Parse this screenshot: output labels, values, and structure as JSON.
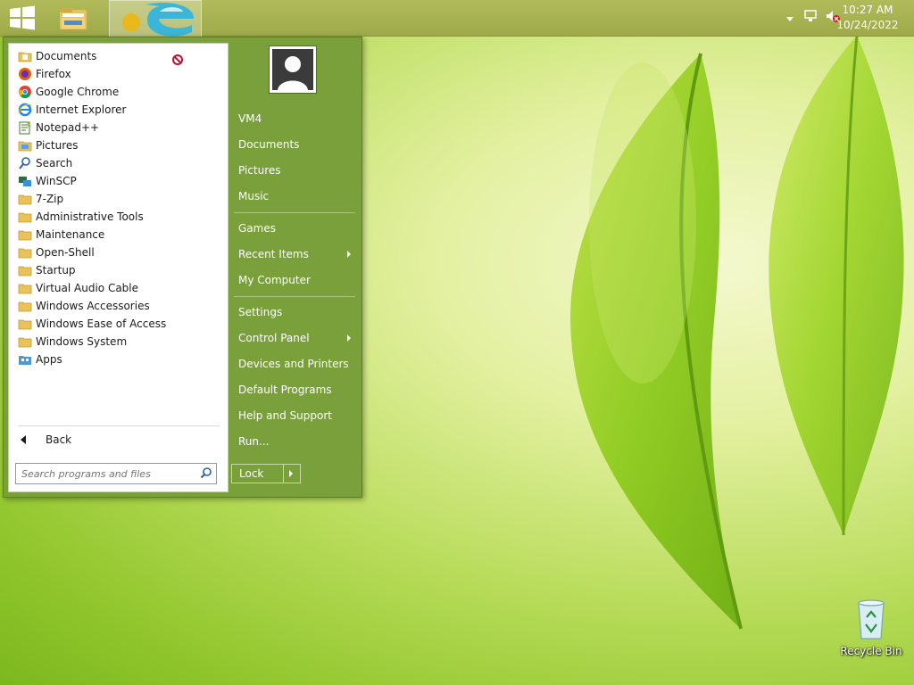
{
  "taskbar": {
    "clock_time": "10:27 AM",
    "clock_date": "10/24/2022",
    "pinned_apps": [
      "file-explorer",
      "internet-explorer"
    ]
  },
  "start_menu": {
    "programs": [
      {
        "label": "Documents",
        "icon": "folder-doc-icon"
      },
      {
        "label": "Firefox",
        "icon": "firefox-icon"
      },
      {
        "label": "Google Chrome",
        "icon": "chrome-icon"
      },
      {
        "label": "Internet Explorer",
        "icon": "ie-icon"
      },
      {
        "label": "Notepad++",
        "icon": "notepad-icon"
      },
      {
        "label": "Pictures",
        "icon": "folder-pictures-icon"
      },
      {
        "label": "Search",
        "icon": "search-icon"
      },
      {
        "label": "WinSCP",
        "icon": "winscp-icon"
      },
      {
        "label": "7-Zip",
        "icon": "folder-icon"
      },
      {
        "label": "Administrative Tools",
        "icon": "folder-icon"
      },
      {
        "label": "Maintenance",
        "icon": "folder-icon"
      },
      {
        "label": "Open-Shell",
        "icon": "folder-icon"
      },
      {
        "label": "Startup",
        "icon": "folder-icon"
      },
      {
        "label": "Virtual Audio Cable",
        "icon": "folder-icon"
      },
      {
        "label": "Windows Accessories",
        "icon": "folder-icon"
      },
      {
        "label": "Windows Ease of Access",
        "icon": "folder-icon"
      },
      {
        "label": "Windows System",
        "icon": "folder-icon"
      },
      {
        "label": "Apps",
        "icon": "apps-icon"
      }
    ],
    "back_label": "Back",
    "search_placeholder": "Search programs and files",
    "right_items": {
      "user": "VM4",
      "documents": "Documents",
      "pictures": "Pictures",
      "music": "Music",
      "games": "Games",
      "recent_items": "Recent Items",
      "my_computer": "My Computer",
      "settings": "Settings",
      "control_panel": "Control Panel",
      "devices_printers": "Devices and Printers",
      "default_programs": "Default Programs",
      "help_support": "Help and Support",
      "run": "Run..."
    },
    "lock_label": "Lock"
  },
  "desktop": {
    "recycle_bin_label": "Recycle Bin"
  },
  "colors": {
    "menu_green": "#7aa03c",
    "taskbar": "#a6b050"
  }
}
